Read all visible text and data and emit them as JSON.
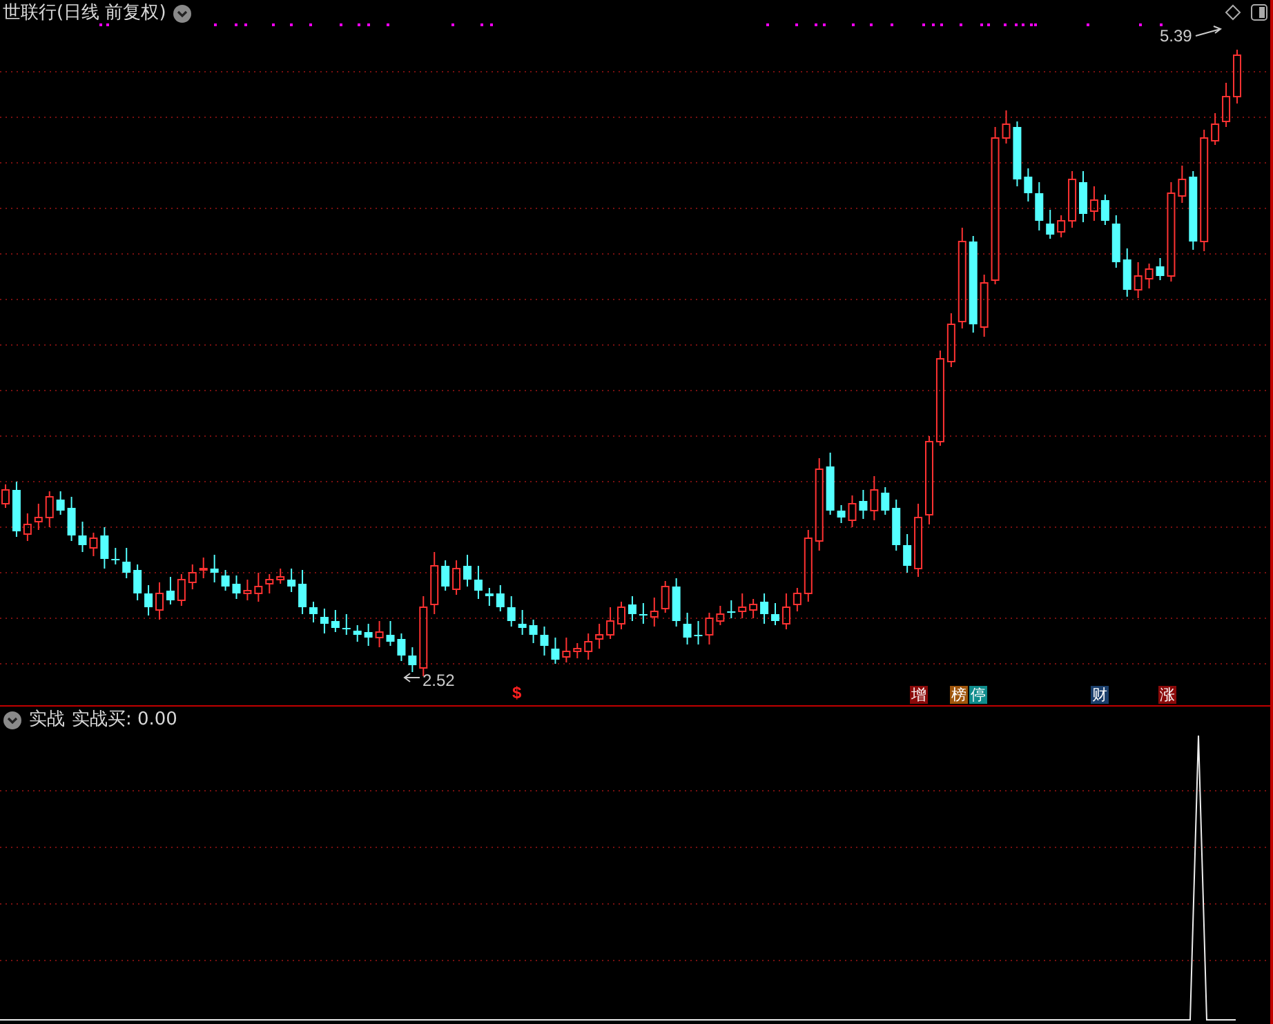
{
  "main_panel": {
    "title": "世联行(日线 前复权)",
    "high_label": "5.39",
    "low_label": "2.52",
    "signal_mark": "$",
    "event_tags": [
      {
        "text": "增",
        "color": "#8b0a0a"
      },
      {
        "text": "榜",
        "color": "#a0560c"
      },
      {
        "text": "停",
        "color": "#0f8c8c"
      },
      {
        "text": "财",
        "color": "#1b3f6c"
      },
      {
        "text": "涨",
        "color": "#8b0a0a"
      }
    ]
  },
  "indicator_panel": {
    "name": "实战",
    "reading": "实战买: 0.00"
  }
}
